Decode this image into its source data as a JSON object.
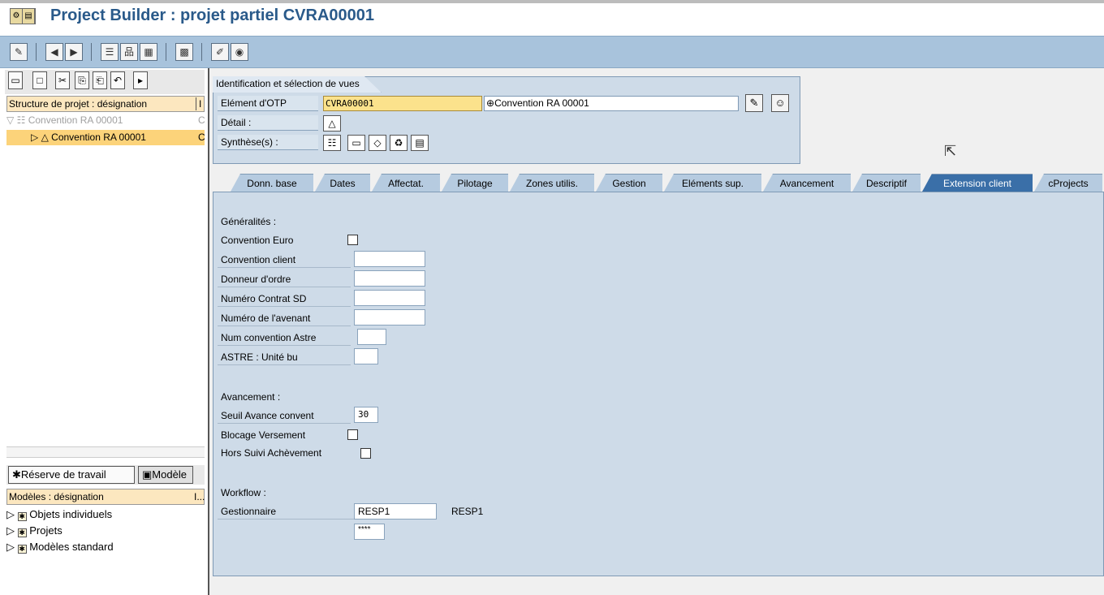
{
  "title": "Project Builder : projet partiel CVRA00001",
  "toolbar": {
    "icons": [
      "display-change-icon",
      "back-icon",
      "forward-icon",
      "hierarchy-icon",
      "network-icon",
      "gantt-icon",
      "calendar-icon",
      "edit-icon",
      "settings-icon"
    ]
  },
  "left": {
    "tree_header": "Structure de projet : désignation",
    "tree_header_col2": "I",
    "tree": [
      {
        "label": "Convention RA 00001",
        "col2": "C",
        "state": "disabled"
      },
      {
        "label": "Convention RA 00001",
        "col2": "C",
        "state": "selected"
      }
    ],
    "bottom_tabs": [
      "Réserve de travail",
      "Modèle"
    ],
    "models_header": "Modèles : désignation",
    "models_header_col2": "I...",
    "models": [
      "Objets individuels",
      "Projets",
      "Modèles standard"
    ]
  },
  "header_panel": {
    "tab": "Identification et sélection de vues",
    "otp_label": "Elément d'OTP",
    "otp_value": "CVRA00001",
    "otp_desc": "Convention RA 00001",
    "detail_label": "Détail :",
    "synthese_label": "Synthèse(s) :"
  },
  "tabs": [
    "Donn. base",
    "Dates",
    "Affectat.",
    "Pilotage",
    "Zones utilis.",
    "Gestion",
    "Eléments sup.",
    "Avancement",
    "Descriptif",
    "Extension client",
    "cProjects"
  ],
  "active_tab": "Extension client",
  "content": {
    "generalites": "Généralités     :",
    "fields": [
      {
        "label": "Convention Euro",
        "type": "checkbox"
      },
      {
        "label": "Convention client",
        "value": ""
      },
      {
        "label": "Donneur d'ordre",
        "value": ""
      },
      {
        "label": "Numéro Contrat SD",
        "value": ""
      },
      {
        "label": "Numéro de l'avenant",
        "value": ""
      },
      {
        "label": "Num convention Astre",
        "value": ""
      },
      {
        "label": "ASTRE : Unité bu",
        "value": ""
      }
    ],
    "avancement": "Avancement  :",
    "seuil_label": "Seuil Avance convent",
    "seuil_value": "30",
    "blocage_label": "Blocage Versement",
    "hors_label": "Hors Suivi Achèvement",
    "workflow": "Workflow :",
    "gestionnaire_label": "Gestionnaire",
    "gestionnaire_value": "RESP1",
    "gestionnaire_text": "RESP1",
    "password_value": "****"
  }
}
